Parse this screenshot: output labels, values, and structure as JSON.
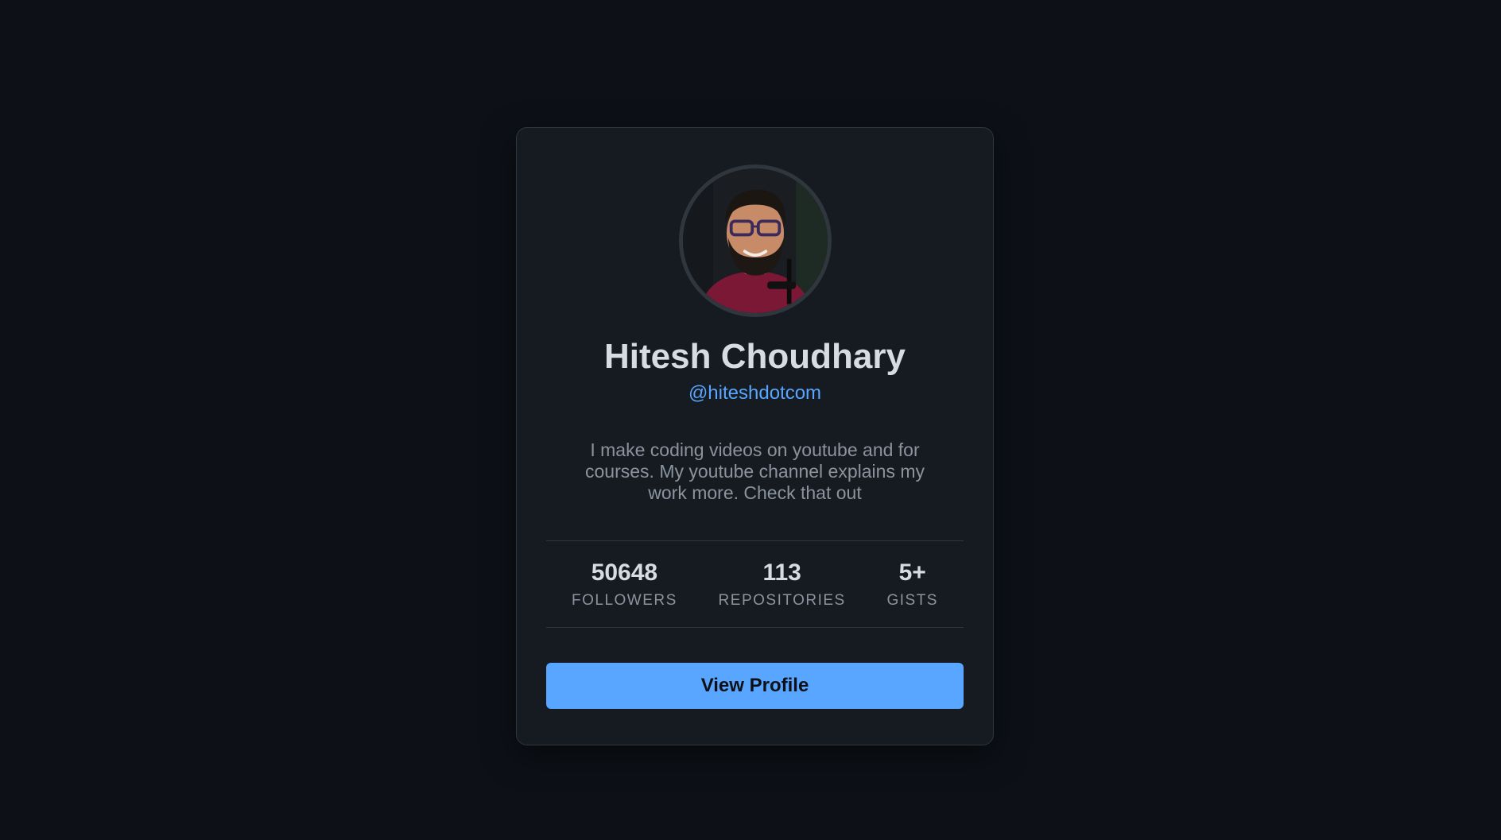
{
  "profile": {
    "name": "Hitesh Choudhary",
    "handle": "@hiteshdotcom",
    "bio": "I make coding videos on youtube and for courses. My youtube channel explains my work more. Check that out"
  },
  "stats": [
    {
      "value": "50648",
      "label": "FOLLOWERS"
    },
    {
      "value": "113",
      "label": "REPOSITORIES"
    },
    {
      "value": "5+",
      "label": "GISTS"
    }
  ],
  "actions": {
    "view_profile_label": "View Profile"
  },
  "colors": {
    "background": "#0d1117",
    "card": "#161b22",
    "accent": "#58a6ff",
    "text_primary": "#d7dce2",
    "text_secondary": "#8b949e"
  }
}
